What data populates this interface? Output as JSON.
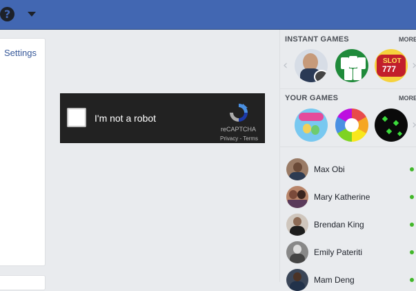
{
  "topbar": {
    "help_icon": "question-circle-icon",
    "menu_icon": "caret-down-icon"
  },
  "left": {
    "settings_link": "Settings"
  },
  "recaptcha": {
    "label": "I'm not a robot",
    "brand": "reCAPTCHA",
    "links": "Privacy - Terms"
  },
  "sidebar": {
    "instant_games": {
      "title": "INSTANT GAMES",
      "more": "MORE"
    },
    "your_games": {
      "title": "YOUR GAMES",
      "more": "MORE"
    },
    "contacts": [
      {
        "name": "Max Obi"
      },
      {
        "name": "Mary Katherine"
      },
      {
        "name": "Brendan King"
      },
      {
        "name": "Emily Pateriti"
      },
      {
        "name": "Mam Deng"
      }
    ]
  },
  "colors": {
    "brand": "#4267b2",
    "online": "#42b72a",
    "link": "#365899"
  }
}
